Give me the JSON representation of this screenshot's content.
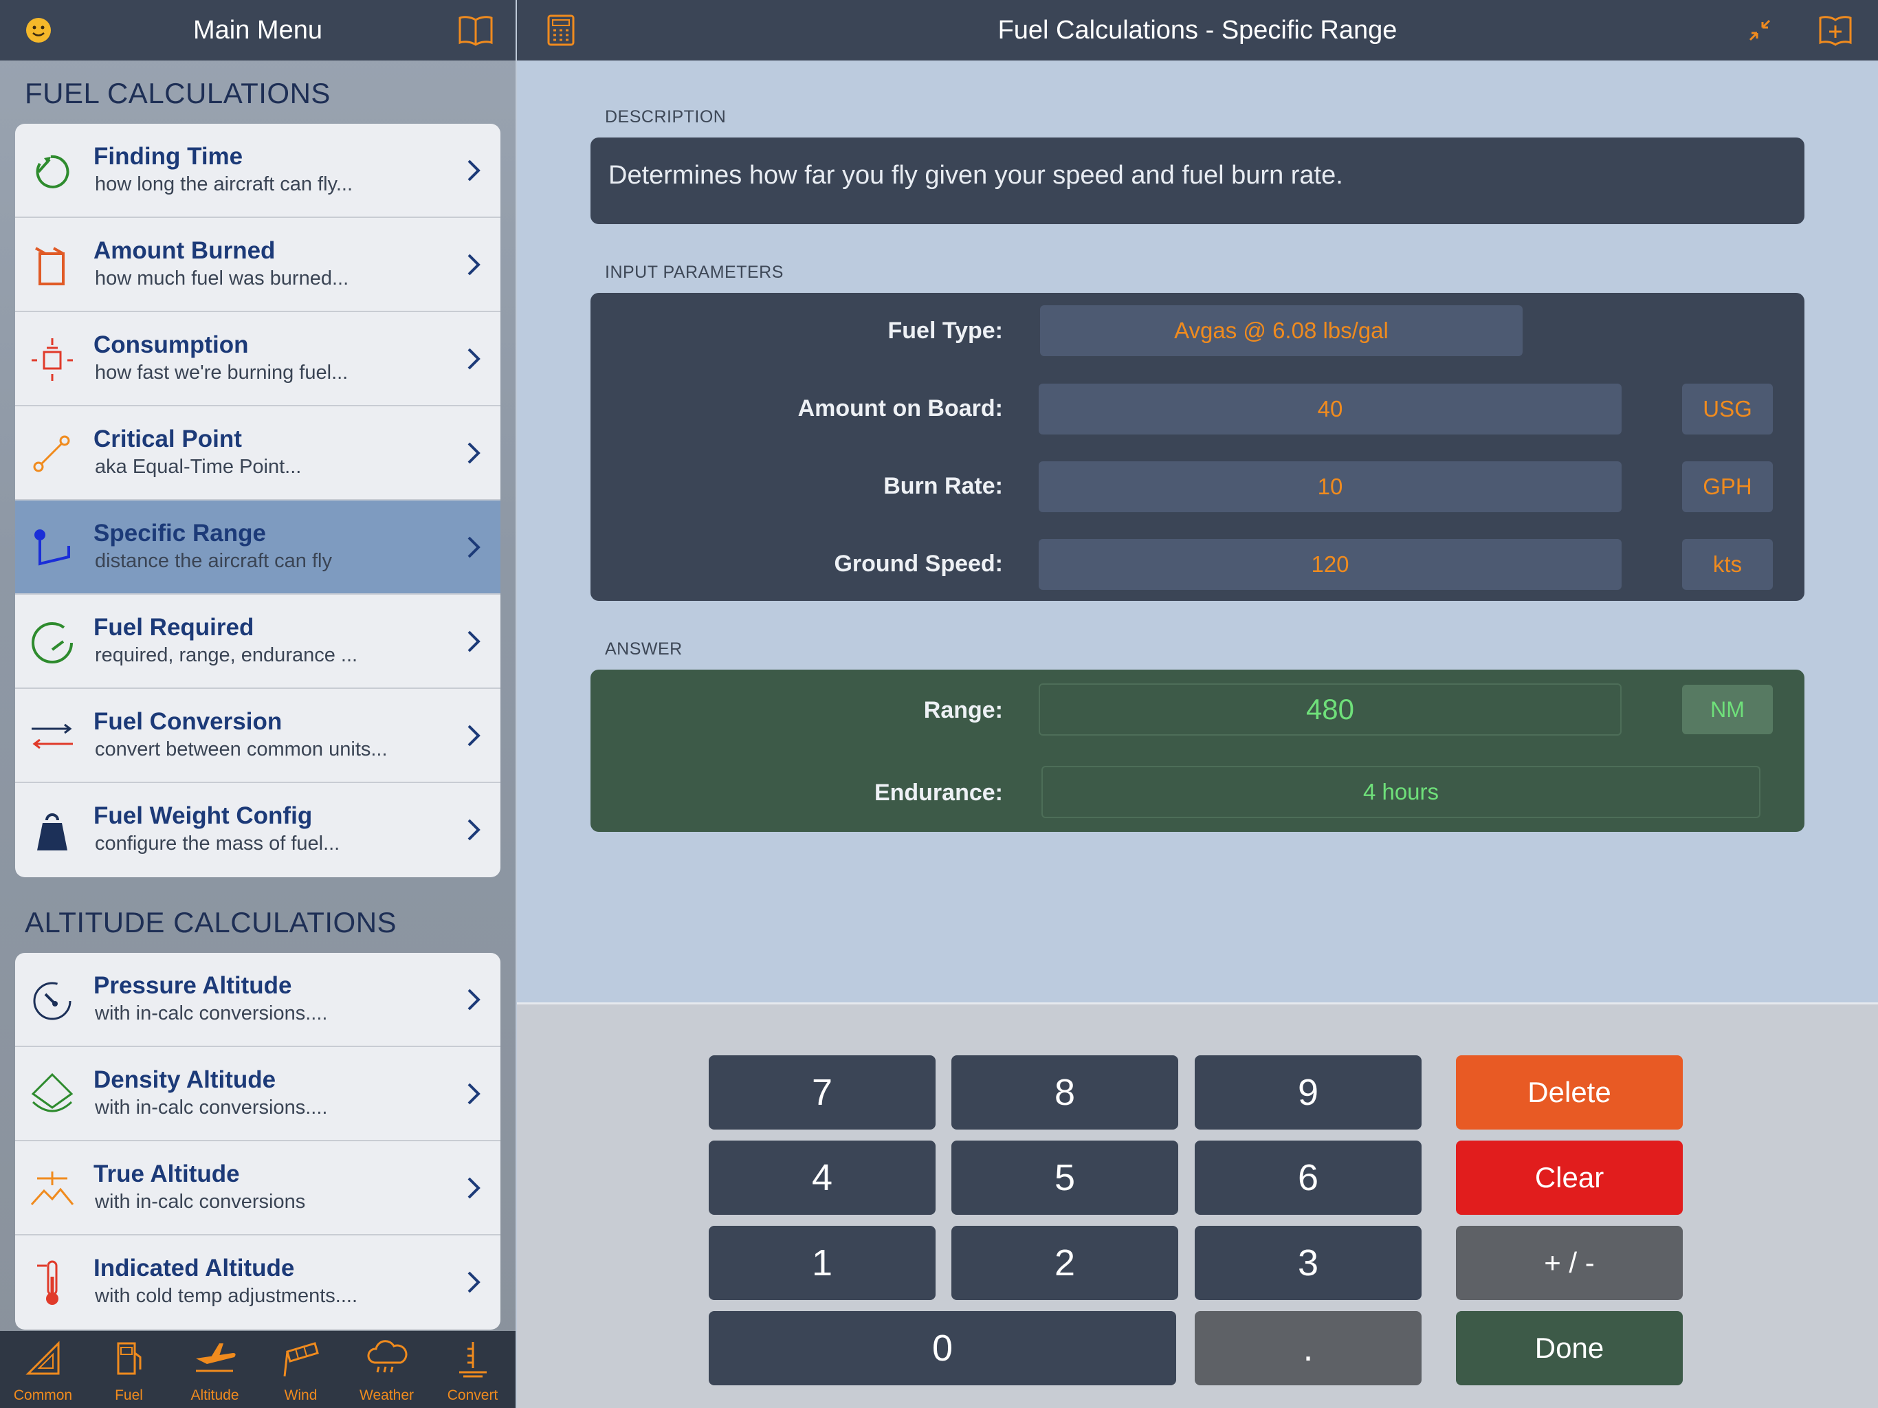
{
  "sidebar": {
    "title": "Main Menu",
    "fuel_section": "FUEL CALCULATIONS",
    "fuel_items": [
      {
        "title": "Finding Time",
        "subtitle": "how long the aircraft can fly...",
        "icon": "timer-icon",
        "color": "#2e8b2e"
      },
      {
        "title": "Amount Burned",
        "subtitle": "how much fuel was burned...",
        "icon": "fuel-can-icon",
        "color": "#e05a26"
      },
      {
        "title": "Consumption",
        "subtitle": "how fast we're burning fuel...",
        "icon": "consumption-icon",
        "color": "#e03a2a"
      },
      {
        "title": "Critical Point",
        "subtitle": "aka Equal-Time Point...",
        "icon": "critical-point-icon",
        "color": "#f08b1e"
      },
      {
        "title": "Specific Range",
        "subtitle": "distance the aircraft can fly",
        "icon": "range-icon",
        "color": "#1a2ed8",
        "selected": true
      },
      {
        "title": "Fuel Required",
        "subtitle": "required, range, endurance ...",
        "icon": "gauge-icon",
        "color": "#2e8b2e"
      },
      {
        "title": "Fuel Conversion",
        "subtitle": "convert between common units...",
        "icon": "conversion-arrows-icon",
        "color": "#e03a2a"
      },
      {
        "title": "Fuel Weight Config",
        "subtitle": "configure the mass of fuel...",
        "icon": "weight-icon",
        "color": "#1c3058"
      }
    ],
    "altitude_section": "ALTITUDE CALCULATIONS",
    "altitude_items": [
      {
        "title": "Pressure Altitude",
        "subtitle": "with in-calc conversions....",
        "icon": "altimeter-icon",
        "color": "#1c3058"
      },
      {
        "title": "Density Altitude",
        "subtitle": "with in-calc conversions....",
        "icon": "density-icon",
        "color": "#2e8b2e"
      },
      {
        "title": "True Altitude",
        "subtitle": "with in-calc conversions",
        "icon": "mountain-icon",
        "color": "#f08b1e"
      },
      {
        "title": "Indicated Altitude",
        "subtitle": "with cold temp adjustments....",
        "icon": "thermometer-icon",
        "color": "#e03a2a"
      }
    ],
    "tabs": [
      {
        "label": "Common",
        "icon": "triangle-ruler-icon"
      },
      {
        "label": "Fuel",
        "icon": "fuel-pump-icon"
      },
      {
        "label": "Altitude",
        "icon": "airplane-icon"
      },
      {
        "label": "Wind",
        "icon": "windsock-icon"
      },
      {
        "label": "Weather",
        "icon": "cloud-rain-icon"
      },
      {
        "label": "Convert",
        "icon": "convert-icon"
      }
    ]
  },
  "main": {
    "title": "Fuel Calculations - Specific Range",
    "description_label": "DESCRIPTION",
    "description": "Determines how far you fly given your speed and fuel burn rate.",
    "inputs_label": "INPUT PARAMETERS",
    "inputs": {
      "fuel_type_label": "Fuel Type:",
      "fuel_type_value": "Avgas @ 6.08 lbs/gal",
      "amount_label": "Amount on Board:",
      "amount_value": "40",
      "amount_unit": "USG",
      "burn_label": "Burn Rate:",
      "burn_value": "10",
      "burn_unit": "GPH",
      "speed_label": "Ground Speed:",
      "speed_value": "120",
      "speed_unit": "kts"
    },
    "answer_label": "ANSWER",
    "answer": {
      "range_label": "Range:",
      "range_value": "480",
      "range_unit": "NM",
      "endurance_label": "Endurance:",
      "endurance_value": "4 hours"
    }
  },
  "keypad": {
    "k7": "7",
    "k8": "8",
    "k9": "9",
    "k4": "4",
    "k5": "5",
    "k6": "6",
    "k1": "1",
    "k2": "2",
    "k3": "3",
    "k0": "0",
    "dot": ".",
    "delete": "Delete",
    "clear": "Clear",
    "sign": "+ / -",
    "done": "Done"
  },
  "colors": {
    "accent_orange": "#f08b1e",
    "answer_green": "#6fe07a",
    "header_bg": "#3b4556"
  }
}
